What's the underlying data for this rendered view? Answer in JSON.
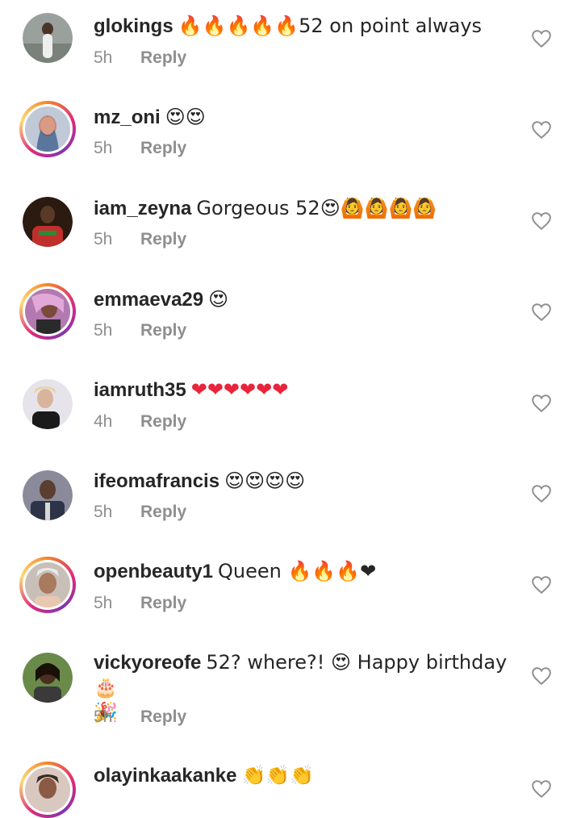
{
  "comments": [
    {
      "username": "glokings",
      "text": "🔥🔥🔥🔥🔥52 on point always",
      "time": "5h",
      "reply": "Reply",
      "story": false
    },
    {
      "username": "mz_oni",
      "text": "😍😍",
      "time": "5h",
      "reply": "Reply",
      "story": true
    },
    {
      "username": "iam_zeyna",
      "text": "Gorgeous  52😍🙆🙆🙆🙆",
      "time": "5h",
      "reply": "Reply",
      "story": false
    },
    {
      "username": "emmaeva29",
      "text": "😍",
      "time": "5h",
      "reply": "Reply",
      "story": true
    },
    {
      "username": "iamruth35",
      "text": "❤❤❤❤❤❤",
      "time": "4h",
      "reply": "Reply",
      "story": false
    },
    {
      "username": "ifeomafrancis",
      "text": "😍😍😍😍",
      "time": "5h",
      "reply": "Reply",
      "story": false
    },
    {
      "username": "openbeauty1",
      "text": "Queen 🔥🔥🔥❤",
      "time": "5h",
      "reply": "Reply",
      "story": true
    },
    {
      "username": "vickyoreofe",
      "text": "52? where?! 😍 Happy birthday 🎂",
      "text2": "🎉",
      "time": "5h",
      "reply": "Reply",
      "story": false
    },
    {
      "username": "olayinkaakanke",
      "text": "👏👏👏",
      "time": "",
      "reply": "",
      "story": true
    }
  ],
  "icons": {
    "like": "heart-outline-icon"
  },
  "colors": {
    "text": "#262626",
    "secondary": "#8e8e8e",
    "story_ring": "#dd2a7b"
  }
}
